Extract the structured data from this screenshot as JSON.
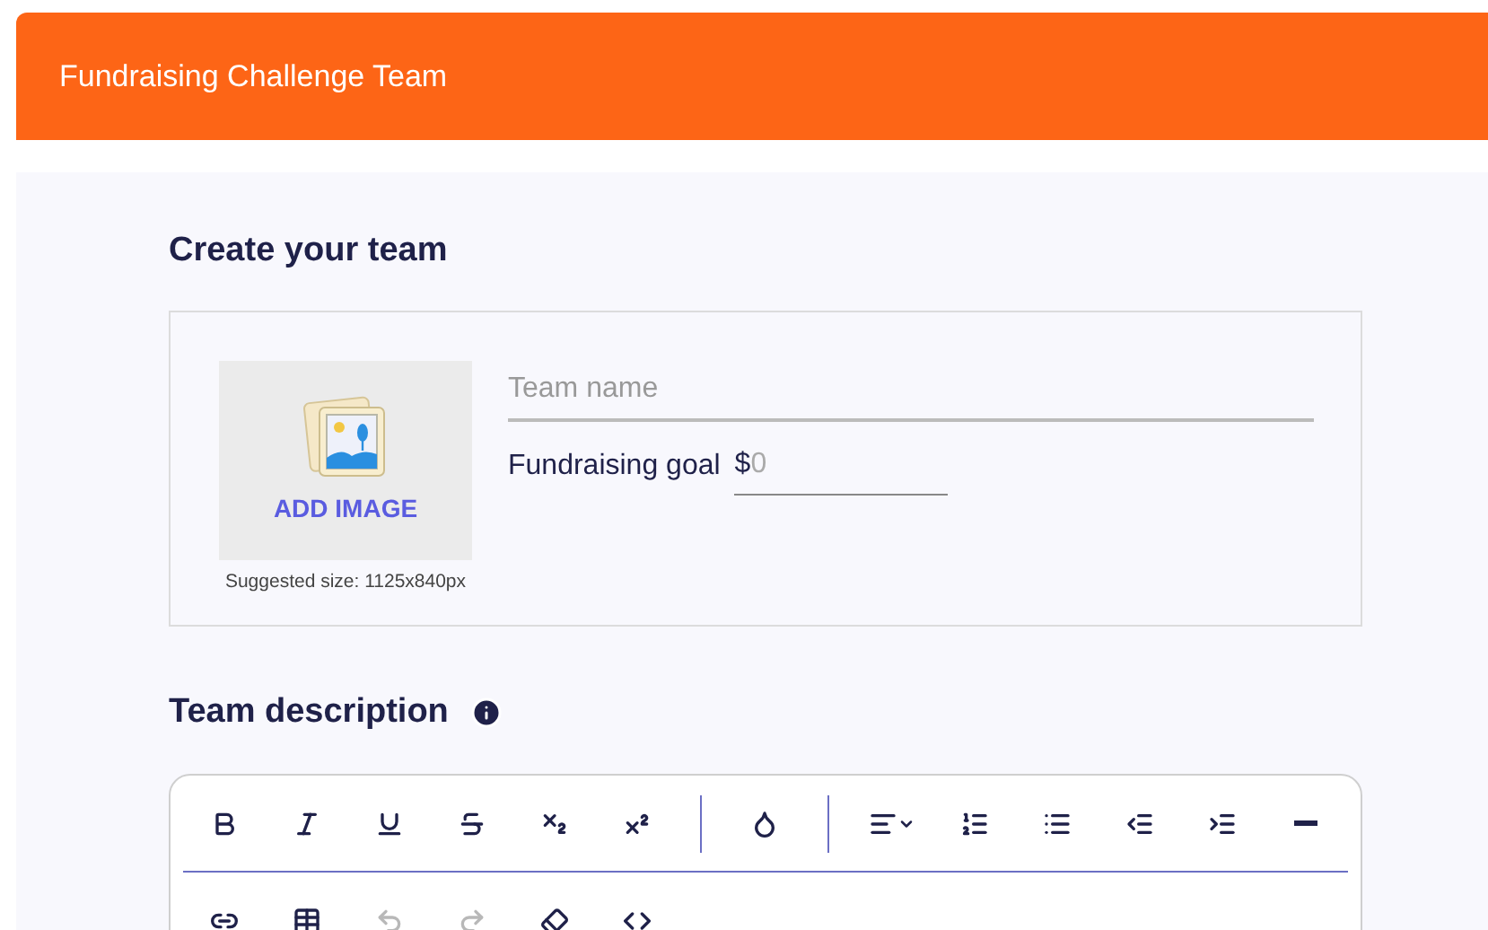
{
  "header": {
    "title": "Fundraising Challenge Team"
  },
  "create": {
    "heading": "Create your team",
    "add_image": "ADD IMAGE",
    "image_hint": "Suggested size: 1125x840px",
    "team_name": {
      "placeholder": "Team name"
    },
    "goal": {
      "label": "Fundraising goal",
      "currency": "$",
      "placeholder": "0"
    }
  },
  "description": {
    "heading": "Team description"
  },
  "toolbar_rows": [
    [
      {
        "kind": "bold",
        "disabled": false
      },
      {
        "kind": "italic",
        "disabled": false
      },
      {
        "kind": "underline",
        "disabled": false
      },
      {
        "kind": "strike",
        "disabled": false
      },
      {
        "kind": "subscript",
        "disabled": false
      },
      {
        "kind": "superscript",
        "disabled": false
      },
      {
        "kind": "separator"
      },
      {
        "kind": "color",
        "disabled": false
      },
      {
        "kind": "separator"
      },
      {
        "kind": "align",
        "disabled": false
      },
      {
        "kind": "ordered",
        "disabled": false
      },
      {
        "kind": "bullets",
        "disabled": false
      },
      {
        "kind": "outdent",
        "disabled": false
      },
      {
        "kind": "indent",
        "disabled": false
      },
      {
        "kind": "rule",
        "disabled": false
      }
    ],
    [
      {
        "kind": "link",
        "disabled": false
      },
      {
        "kind": "table",
        "disabled": false
      },
      {
        "kind": "undo",
        "disabled": true
      },
      {
        "kind": "redo",
        "disabled": true
      },
      {
        "kind": "eraser",
        "disabled": false
      },
      {
        "kind": "code",
        "disabled": false
      }
    ]
  ]
}
